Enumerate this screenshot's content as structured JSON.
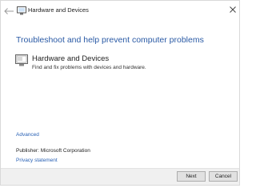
{
  "window": {
    "title": "Hardware and Devices",
    "icons": {
      "back": "back-arrow-icon",
      "title": "troubleshoot-icon",
      "close": "close-icon"
    }
  },
  "main": {
    "heading": "Troubleshoot and help prevent computer problems",
    "item": {
      "title": "Hardware and Devices",
      "description": "Find and fix problems with devices and hardware.",
      "icon": "hardware-devices-icon"
    },
    "advanced_link": "Advanced",
    "publisher_label": "Publisher:",
    "publisher_value": "Microsoft Corporation",
    "privacy_link": "Privacy statement"
  },
  "footer": {
    "next_label": "Next",
    "cancel_label": "Cancel"
  },
  "colors": {
    "heading": "#2a5aa5",
    "link": "#2a62b5",
    "footer_bg": "#f0f0f0"
  }
}
